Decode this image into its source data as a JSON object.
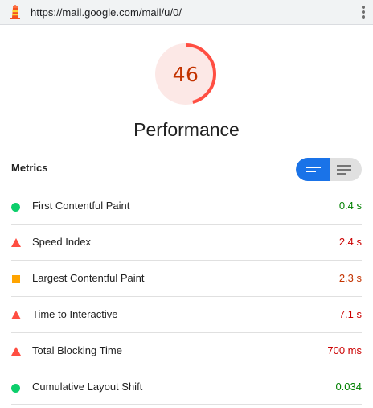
{
  "browser": {
    "url": "https://mail.google.com/mail/u/0/"
  },
  "score": {
    "value": "46",
    "fraction": 0.46,
    "category": "Performance",
    "ring_color": "#ff4e42",
    "ring_track_color": "#fce8e6",
    "text_color": "#c33300"
  },
  "metrics": {
    "label": "Metrics",
    "toggle": {
      "selected": "compact-view",
      "options": [
        "compact-view-icon",
        "expanded-view-icon"
      ]
    },
    "items": [
      {
        "name": "First Contentful Paint",
        "value": "0.4 s",
        "status": "pass",
        "icon": "circle"
      },
      {
        "name": "Speed Index",
        "value": "2.4 s",
        "status": "fail",
        "icon": "triangle"
      },
      {
        "name": "Largest Contentful Paint",
        "value": "2.3 s",
        "status": "average",
        "icon": "square"
      },
      {
        "name": "Time to Interactive",
        "value": "7.1 s",
        "status": "fail",
        "icon": "triangle"
      },
      {
        "name": "Total Blocking Time",
        "value": "700 ms",
        "status": "fail",
        "icon": "triangle"
      },
      {
        "name": "Cumulative Layout Shift",
        "value": "0.034",
        "status": "pass",
        "icon": "circle"
      }
    ]
  },
  "colors": {
    "pass": "#0cce6b",
    "average": "#ffa400",
    "fail": "#ff4e42",
    "accent": "#1a73e8"
  }
}
